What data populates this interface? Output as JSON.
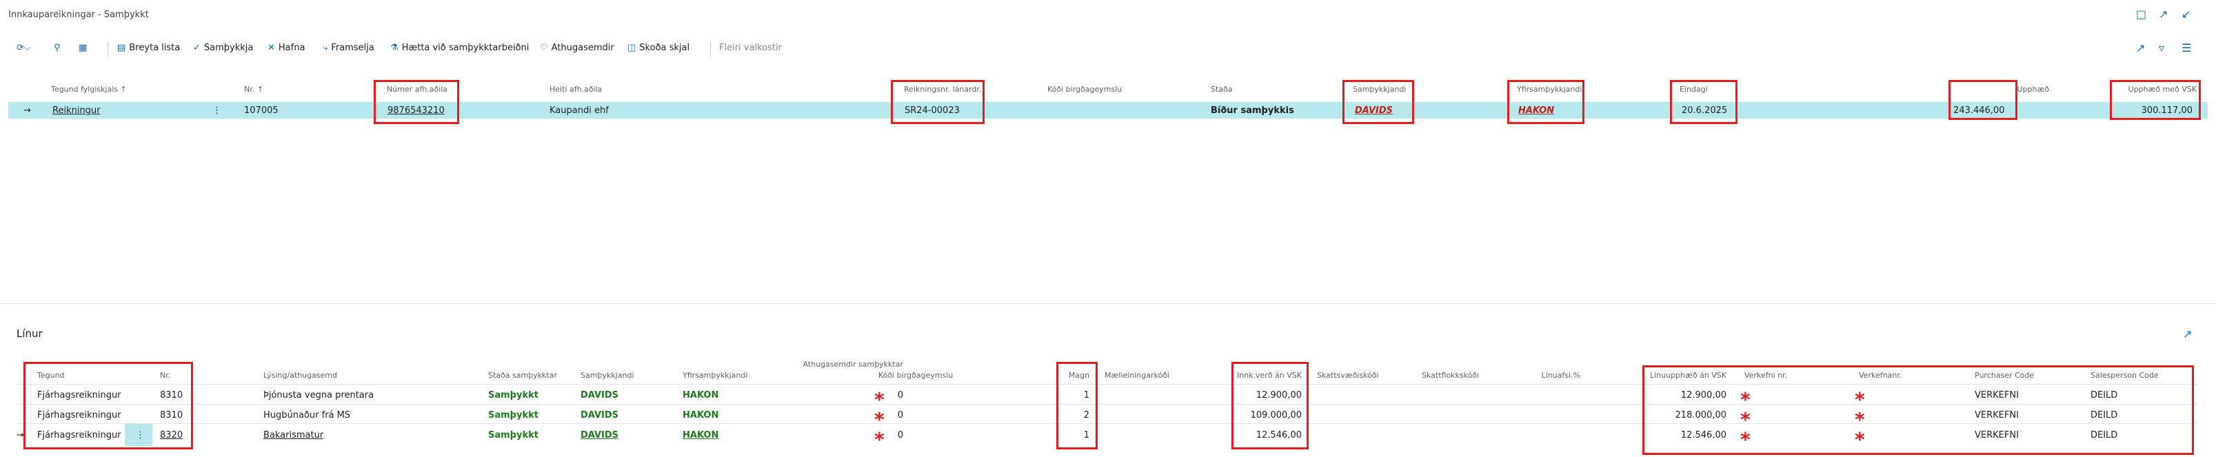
{
  "window": {
    "title": "Innkaupareikningar - Samþykkt"
  },
  "commands": {
    "edit_list": "Breyta lista",
    "approve": "Samþykkja",
    "reject": "Hafna",
    "forward": "Framselja",
    "cancel_workflow": "Hætta við samþykktarbeiðni",
    "comments": "Athugasemdir",
    "view_document": "Skoða skjal",
    "more_options": "Fleiri valkostir"
  },
  "header_columns": {
    "doc_type": "Tegund fylgiskjals ↑",
    "no": "Nr. ↑",
    "vendor_no": "Númer afh.aðila",
    "vendor_name": "Heiti afh.aðila",
    "invoice_no": "Reikningsnr. lánardr.",
    "storage_code": "Kóði birgðageymslu",
    "status": "Staða",
    "approver": "Samþykkjandi",
    "senior_approver": "Yfirsamþykkjandi",
    "due_date": "Eindagi",
    "amount": "Upphæð",
    "amount_vat": "Upphæð með VSK"
  },
  "header_row": {
    "doc_type": "Reikningur",
    "no": "107005",
    "vendor_no": "9876543210",
    "vendor_name": "Kaupandi ehf",
    "invoice_no": "SR24-00023",
    "status": "Bíður samþykkis",
    "approver": "DAVIDS",
    "senior_approver": "HAKON",
    "due_date": "20.6.2025",
    "amount": "243.446,00",
    "amount_vat": "300.117,00"
  },
  "lines_section": {
    "title": "Línur"
  },
  "line_columns": {
    "type": "Tegund",
    "no": "Nr.",
    "description": "Lýsing/athugasemd",
    "approval_status": "Staða samþykktar",
    "approver": "Samþykkjandi",
    "senior_approver": "Yfirsamþykkjandi",
    "comments": "Athugasemdir samþykktar",
    "storage_code": "Kóði birgðageymslu",
    "quantity": "Magn",
    "unit_code": "Mælieiningarkóði",
    "unit_cost": "Innk.verð án VSK",
    "vat_code": "Skattsvæðiskóði",
    "tax_group": "Skattflokkskóði",
    "line_discount": "Línuafsl.%",
    "line_amount": "Línuupphæð án VSK",
    "project_no": "Verkefni nr.",
    "project_name": "Verkefnanr.",
    "purchaser_code": "Purchaser Code",
    "salesperson_code": "Salesperson Code"
  },
  "lines": [
    {
      "type": "Fjárhagsreikningur",
      "no": "8310",
      "description": "Þjónusta vegna prentara",
      "approval_status": "Samþykkt",
      "approver": "DAVIDS",
      "senior_approver": "HAKON",
      "comments": "0",
      "quantity": "1",
      "unit_cost": "12.900,00",
      "line_amount": "12.900,00",
      "purchaser_code": "VERKEFNI",
      "salesperson_code": "DEILD"
    },
    {
      "type": "Fjárhagsreikningur",
      "no": "8310",
      "description": "Hugbúnaður frá MS",
      "approval_status": "Samþykkt",
      "approver": "DAVIDS",
      "senior_approver": "HAKON",
      "comments": "0",
      "quantity": "2",
      "unit_cost": "109.000,00",
      "line_amount": "218.000,00",
      "purchaser_code": "VERKEFNI",
      "salesperson_code": "DEILD"
    },
    {
      "type": "Fjárhagsreikningur",
      "no": "8320",
      "description": "Bakarismatur",
      "approval_status": "Samþykkt",
      "approver": "DAVIDS",
      "senior_approver": "HAKON",
      "comments": "0",
      "quantity": "1",
      "unit_cost": "12.546,00",
      "line_amount": "12.546,00",
      "purchaser_code": "VERKEFNI",
      "salesperson_code": "DEILD"
    }
  ],
  "markers": {
    "required": "*",
    "row_arrow": "→",
    "row_menu": "⋮"
  },
  "colors": {
    "accent": "#0f6cbd",
    "selected_row": "#b6e8ec",
    "approved": "#1e7b1e",
    "highlight": "#e01e1e"
  }
}
